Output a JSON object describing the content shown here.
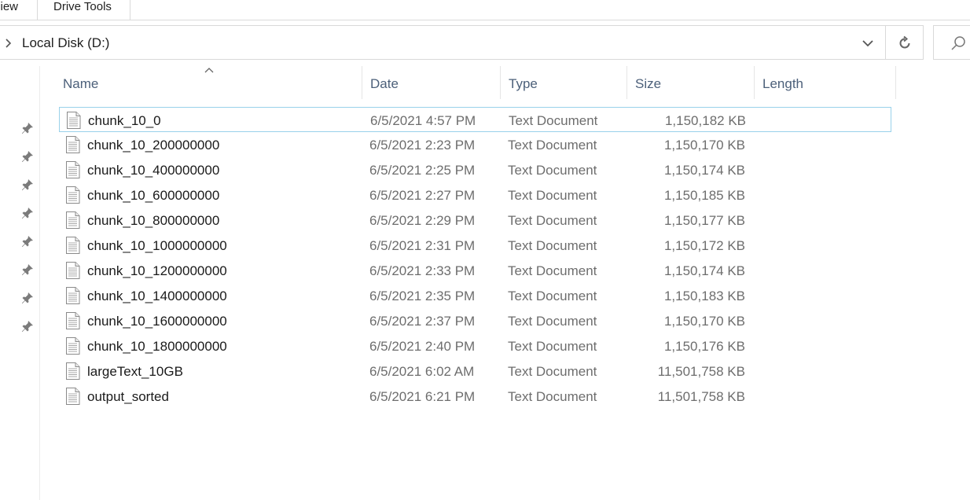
{
  "ribbon": {
    "tabs": [
      "iew",
      "Drive Tools"
    ]
  },
  "address": {
    "path": "Local Disk (D:)"
  },
  "columns": [
    "Name",
    "Date",
    "Type",
    "Size",
    "Length"
  ],
  "files": [
    {
      "name": "chunk_10_0",
      "date": "6/5/2021 4:57 PM",
      "type": "Text Document",
      "size": "1,150,182 KB"
    },
    {
      "name": "chunk_10_200000000",
      "date": "6/5/2021 2:23 PM",
      "type": "Text Document",
      "size": "1,150,170 KB"
    },
    {
      "name": "chunk_10_400000000",
      "date": "6/5/2021 2:25 PM",
      "type": "Text Document",
      "size": "1,150,174 KB"
    },
    {
      "name": "chunk_10_600000000",
      "date": "6/5/2021 2:27 PM",
      "type": "Text Document",
      "size": "1,150,185 KB"
    },
    {
      "name": "chunk_10_800000000",
      "date": "6/5/2021 2:29 PM",
      "type": "Text Document",
      "size": "1,150,177 KB"
    },
    {
      "name": "chunk_10_1000000000",
      "date": "6/5/2021 2:31 PM",
      "type": "Text Document",
      "size": "1,150,172 KB"
    },
    {
      "name": "chunk_10_1200000000",
      "date": "6/5/2021 2:33 PM",
      "type": "Text Document",
      "size": "1,150,174 KB"
    },
    {
      "name": "chunk_10_1400000000",
      "date": "6/5/2021 2:35 PM",
      "type": "Text Document",
      "size": "1,150,183 KB"
    },
    {
      "name": "chunk_10_1600000000",
      "date": "6/5/2021 2:37 PM",
      "type": "Text Document",
      "size": "1,150,170 KB"
    },
    {
      "name": "chunk_10_1800000000",
      "date": "6/5/2021 2:40 PM",
      "type": "Text Document",
      "size": "1,150,176 KB"
    },
    {
      "name": "largeText_10GB",
      "date": "6/5/2021 6:02 AM",
      "type": "Text Document",
      "size": "11,501,758 KB"
    },
    {
      "name": "output_sorted",
      "date": "6/5/2021 6:21 PM",
      "type": "Text Document",
      "size": "11,501,758 KB"
    }
  ]
}
